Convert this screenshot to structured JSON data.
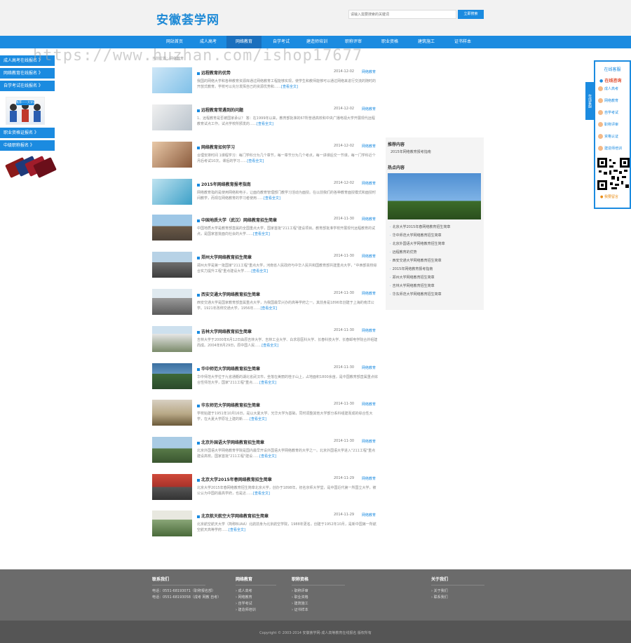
{
  "header": {
    "logo": "安徽荟学网",
    "search_placeholder": "请输入需要搜索的关键词",
    "search_button": "立即搜索"
  },
  "nav": [
    "网站首页",
    "成人高考",
    "网络教育",
    "自学考试",
    "建造师培训",
    "职称评审",
    "职业资格",
    "建筑施工",
    "证书样本"
  ],
  "nav_active": "网络教育",
  "left_float": {
    "links": [
      "成人高考在线报名 》",
      "网络教育在线报名 》",
      "自学考试在线报名 》",
      "职业资格证报名 》",
      "中级职称报名 》"
    ],
    "promo_text": "推荐——大学读了"
  },
  "breadcrumb": "当前位置：网络教育",
  "articles": [
    {
      "title": "远程教育的优势",
      "date": "2014-12-02",
      "cat": "网络教育",
      "summary": "我国的网络大学和各种教育资源库通过网络教育工程能够实现，使学生和教师能够可以通过网络来进行交流的随时的开放式教育。学校可以充分发挥自己的资源优势和……",
      "more": "[查看全文]"
    },
    {
      "title": "远程教育常遇到的问题",
      "date": "2014-12-02",
      "cat": "网络教育",
      "summary": "1、远程教育是否被国家承认？ 答：在1999年以来，教育部批准的67所普通高校和中央广播电视大学开展现代远程教育试点工作。试点学校所颁发的……",
      "more": "[查看全文]"
    },
    {
      "title": "网络教育如何学习",
      "date": "2014-12-02",
      "cat": "网络教育",
      "summary": "合理安排时间 1课程学习：每门学科分为几个章节，每一章节分为几个考点，每一讲课后交一节课，每一门学科近个月后考试10次，课后的学习……",
      "more": "[查看全文]"
    },
    {
      "title": "2015年网络教育报考指南",
      "date": "2014-12-02",
      "cat": "网络教育",
      "summary": "网络教育指的是使用网络和电子，让面向教育管理部门教学习活动为面授。在以前我们的各种教育面授模式和面授时间教学，而现在网络教育的学习者使用……",
      "more": "[查看全文]"
    },
    {
      "title": "中国地质大学（武汉）网络教育招生简章",
      "date": "2014-11-30",
      "cat": "网络教育",
      "summary": "中国地质大学是教育部直属的全国重点大学，国家首批\"211工程\"建设项目。教育部批准学校开展现代远程教育的试点，是国家首批面向社会的大学……",
      "more": "[查看全文]"
    },
    {
      "title": "郑州大学网络教育招生简章",
      "date": "2014-11-30",
      "cat": "网络教育",
      "summary": "郑州大学是第一批国家\"211工程\"重点大学，河南省人民政府与中华人民共和国教育部共建重点大学，\"中西部高校综合实力提升工程\"重点建设大学……",
      "more": "[查看全文]"
    },
    {
      "title": "西安交通大学网络教育招生简章",
      "date": "2014-11-30",
      "cat": "网络教育",
      "summary": "西安交通大学是国家教育部直属重点大学，为我国最早兴办的高等学府之一。其前身是1896年创建于上海的南洋公学。1921年改称交通大学，1956年……",
      "more": "[查看全文]"
    },
    {
      "title": "吉林大学网络教育招生简章",
      "date": "2014-11-30",
      "cat": "网络教育",
      "summary": "吉林大学于2000年6月12日由原吉林大学、吉林工业大学、白求恩医科大学、长春科技大学、长春邮电学院合并组建而成。2004年8月29日，原中国人民……",
      "more": "[查看全文]"
    },
    {
      "title": "华中师范大学网络教育招生简章",
      "date": "2014-11-30",
      "cat": "网络教育",
      "summary": "华中师范大学位于九省通衢的湖北省武汉市，坐落在美丽的桂子山上，占地面积1800余亩，是中国教育部直属重点综合性师范大学，国家\"211工程\"重点……",
      "more": "[查看全文]"
    },
    {
      "title": "华东师范大学网络教育招生简章",
      "date": "2014-11-30",
      "cat": "网络教育",
      "summary": "学校始建于1951年10月16日，是以大夏大学、光华大学为基础，同时调整其他大学部分系科组建而成的综合性大学，在大夏大学原址上建的新……",
      "more": "[查看全文]"
    },
    {
      "title": "北京外国语大学网络教育招生简章",
      "date": "2014-11-30",
      "cat": "网络教育",
      "summary": "北京外国语大学网络教育学院是国内最早开设外国语大学网络教育的大学之一。北京外国语大学进入\"211工程\"重点建设高校。国家首批\"211工程\"建设……",
      "more": "[查看全文]"
    },
    {
      "title": "北京大学2015年春网络教育招生简章",
      "date": "2014-11-29",
      "cat": "网络教育",
      "summary": "北京大学2015年春网络教育招生简章北京大学，创办于1898年，初名京师大学堂，是中国近代第一所国立大学，被公认为中国的最高学府，也是近……",
      "more": "[查看全文]"
    },
    {
      "title": "北京航天航空大学网络教育招生简章",
      "date": "2014-11-29",
      "cat": "网络教育",
      "summary": "北京航空航天大学（简称BUAA）北航前身为北京航空学院，1988年更名。创建于1952年10月，是新中国第一所航空航天高等学府……",
      "more": "[查看全文]"
    }
  ],
  "sidebar": {
    "recommend_title": "推荐内容",
    "recommend_items": [
      "2015年网络教育报考指南"
    ],
    "hot_title": "热点内容",
    "hot_items": [
      "北京大学2015年春网络教育招生简章",
      "华中师范大学网络教育招生简章",
      "北京外国语大学网络教育招生简章",
      "远程教育的优势",
      "西安交通大学网络教育招生简章",
      "2015年网络教育报考指南",
      "郑州大学网络教育招生简章",
      "吉林大学网络教育招生简章",
      "华东师范大学网络教育招生简章"
    ]
  },
  "right_float": {
    "tab": "在线客服",
    "head": "在线客服",
    "online": "在线咨询",
    "items": [
      "成人高考",
      "网络教育",
      "自学考试",
      "职称评审",
      "资格认证",
      "建造师培训"
    ],
    "message": "我要留言"
  },
  "footer": {
    "col1_title": "联系我们",
    "col1_items": [
      "电话：0551-68193071（职称报名部）",
      "电话：0551-68193058（成考 网教 自考）"
    ],
    "col2_title": "网络教育",
    "col2_items": [
      "› 成人高考",
      "› 网络教育",
      "› 自学考试",
      "› 建造师培训"
    ],
    "col3_title": "职称资格",
    "col3_items": [
      "› 职称评审",
      "› 职业资格",
      "› 建筑施工",
      "› 证书样本"
    ],
    "col4_title": "关于我们",
    "col4_items": [
      "› 关于我们",
      "› 联系我们"
    ],
    "copyright": "Copyright © 2003-2014 安徽荟学网-成人高等教育在线报名 版权所有"
  },
  "watermark": "https://www.huzhan.com/ishop17677",
  "colors": {
    "primary": "#1b8be0",
    "footer": "#6b6b6b"
  }
}
